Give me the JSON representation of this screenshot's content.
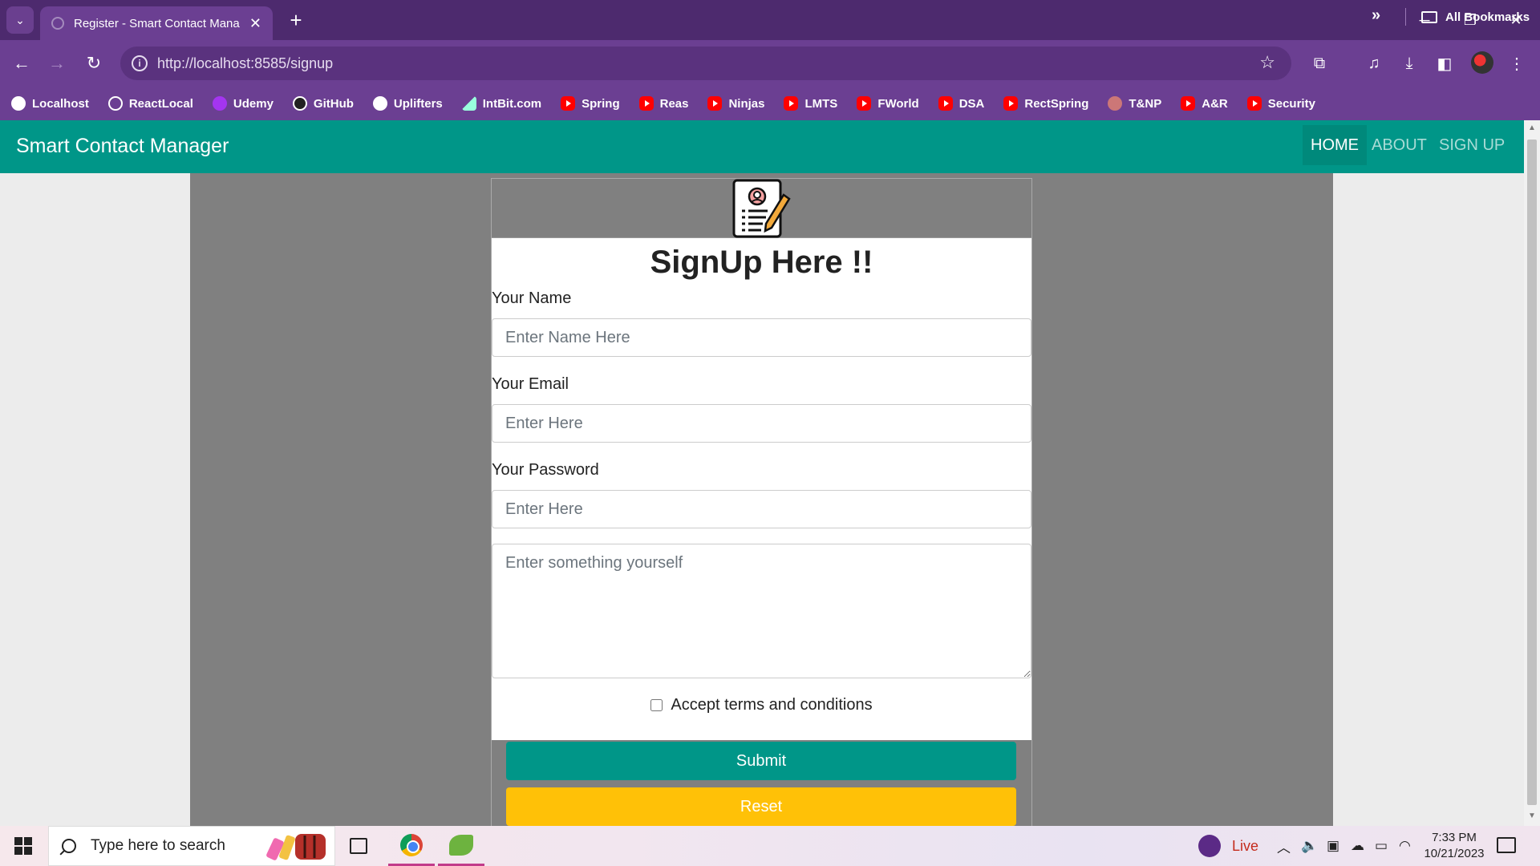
{
  "browser": {
    "tab_title": "Register - Smart Contact Mana",
    "tab_close": "✕",
    "new_tab": "+",
    "url": "http://localhost:8585/signup",
    "window_controls": {
      "minimize": "─",
      "restore": "❐",
      "close": "✕"
    },
    "bookmarks": [
      {
        "label": "Localhost",
        "icon": "globe-icon"
      },
      {
        "label": "ReactLocal",
        "icon": "react-icon"
      },
      {
        "label": "Udemy",
        "icon": "udemy-icon"
      },
      {
        "label": "GitHub",
        "icon": "github-icon"
      },
      {
        "label": "Uplifters",
        "icon": "globe-icon"
      },
      {
        "label": "IntBit.com",
        "icon": "mountain-icon"
      },
      {
        "label": "Spring",
        "icon": "youtube-icon"
      },
      {
        "label": "Reas",
        "icon": "youtube-icon"
      },
      {
        "label": "Ninjas",
        "icon": "youtube-icon"
      },
      {
        "label": "LMTS",
        "icon": "youtube-icon"
      },
      {
        "label": "FWorld",
        "icon": "youtube-icon"
      },
      {
        "label": "DSA",
        "icon": "youtube-icon"
      },
      {
        "label": "RectSpring",
        "icon": "youtube-icon"
      },
      {
        "label": "T&NP",
        "icon": "tnp-icon"
      },
      {
        "label": "A&R",
        "icon": "youtube-icon"
      },
      {
        "label": "Security",
        "icon": "youtube-icon"
      }
    ],
    "bookmarks_more": "»",
    "all_bookmarks": "All Bookmarks"
  },
  "navbar": {
    "brand": "Smart Contact Manager",
    "links": [
      "HOME",
      "ABOUT",
      "SIGN UP"
    ],
    "active": "HOME",
    "color": "#009688"
  },
  "form": {
    "title": "SignUp Here !!",
    "name_label": "Your Name",
    "name_placeholder": "Enter Name Here",
    "email_label": "Your Email",
    "email_placeholder": "Enter Here",
    "password_label": "Your Password",
    "password_placeholder": "Enter Here",
    "about_placeholder": "Enter something yourself",
    "terms_label": "Accept terms and conditions",
    "terms_checked": false,
    "submit_label": "Submit",
    "reset_label": "Reset",
    "submit_color": "#009688",
    "reset_color": "#ffc107"
  },
  "taskbar": {
    "search_placeholder": "Type here to search",
    "live_label": "Live",
    "time": "7:33 PM",
    "date": "10/21/2023"
  }
}
